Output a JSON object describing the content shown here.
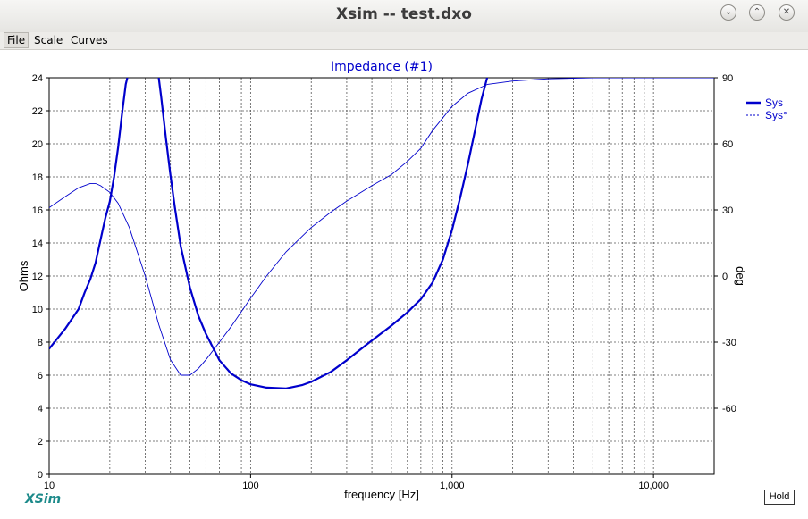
{
  "window": {
    "title": "Xsim -- test.dxo"
  },
  "menu": {
    "items": [
      "File",
      "Scale",
      "Curves"
    ]
  },
  "hold_label": "Hold",
  "logo_text": "XSim",
  "chart_data": {
    "type": "line",
    "title": "Impedance (#1)",
    "xlabel": "frequency [Hz]",
    "ylabel": "Ohms",
    "y2label": "deg",
    "xscale": "log",
    "xlim": [
      10,
      20000
    ],
    "ylim": [
      0,
      24
    ],
    "y2lim": [
      -90,
      90
    ],
    "xticks": [
      10,
      100,
      1000,
      10000
    ],
    "xticklabels": [
      "10",
      "100",
      "1,000",
      "10,000"
    ],
    "yticks": [
      0,
      2,
      4,
      6,
      8,
      10,
      12,
      14,
      16,
      18,
      20,
      22,
      24
    ],
    "y2ticks": [
      -60,
      -30,
      0,
      30,
      60,
      90
    ],
    "grid": true,
    "legend": "right",
    "line_color": "#0000cc",
    "series": [
      {
        "name": "Sys",
        "axis": "left",
        "style": "solid",
        "x": [
          10,
          12,
          14,
          15,
          16,
          17,
          18,
          19,
          20,
          21,
          22,
          23,
          24,
          25,
          30,
          34,
          35,
          36,
          38,
          40,
          42,
          45,
          50,
          55,
          60,
          70,
          80,
          90,
          100,
          120,
          150,
          180,
          200,
          250,
          300,
          400,
          500,
          600,
          700,
          800,
          900,
          1000,
          1100,
          1200,
          1300,
          1400,
          1500
        ],
        "y": [
          7.6,
          8.8,
          10.0,
          11.0,
          11.8,
          12.8,
          14.2,
          15.5,
          16.5,
          18.0,
          19.8,
          21.8,
          23.6,
          24.5,
          25.5,
          25,
          24.0,
          22.8,
          20.3,
          18.1,
          16.2,
          13.8,
          11.3,
          9.6,
          8.5,
          6.9,
          6.1,
          5.7,
          5.45,
          5.25,
          5.2,
          5.4,
          5.6,
          6.2,
          6.9,
          8.1,
          9.0,
          9.8,
          10.6,
          11.6,
          13.0,
          14.8,
          16.8,
          18.8,
          20.8,
          22.7,
          24.1
        ]
      },
      {
        "name": "Sys°",
        "axis": "right",
        "style": "dashed",
        "x": [
          10,
          12,
          14,
          16,
          17,
          18,
          20,
          22,
          25,
          30,
          35,
          40,
          45,
          50,
          55,
          60,
          70,
          80,
          100,
          120,
          150,
          200,
          250,
          300,
          400,
          500,
          600,
          700,
          800,
          1000,
          1200,
          1500,
          2000,
          3000,
          5000,
          10000,
          20000
        ],
        "y": [
          31,
          36,
          40,
          42,
          42,
          41,
          38,
          33,
          22,
          0,
          -22,
          -38,
          -45,
          -45,
          -42,
          -38,
          -30,
          -23,
          -10,
          0,
          11,
          22,
          29,
          34,
          41,
          46,
          52,
          58,
          66,
          77,
          83,
          87,
          88.5,
          89.5,
          90,
          90,
          90
        ]
      }
    ]
  }
}
